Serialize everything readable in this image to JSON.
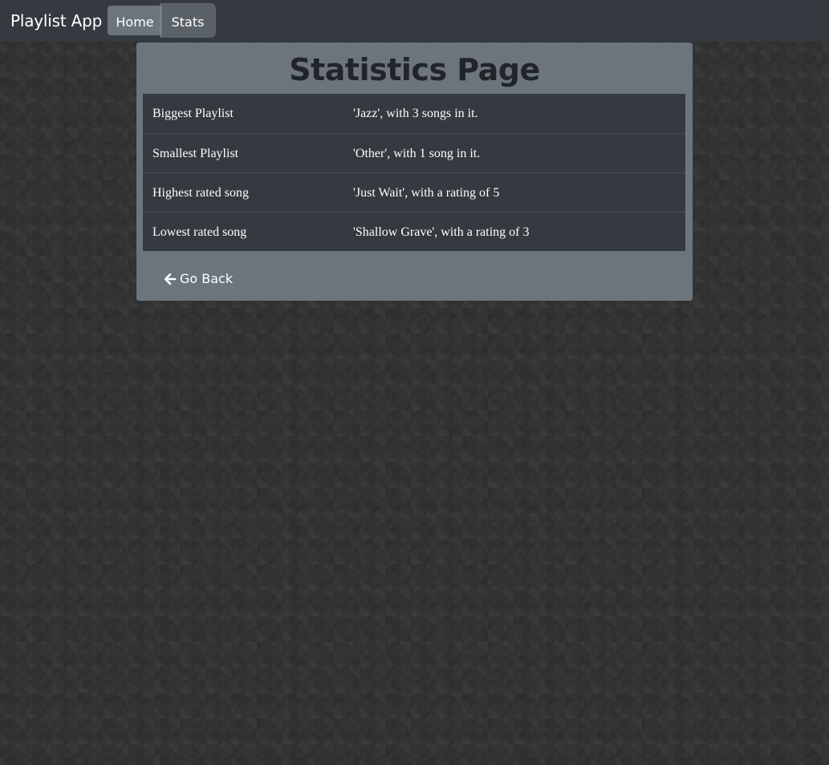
{
  "navbar": {
    "brand": "Playlist App",
    "links": [
      {
        "label": "Home"
      },
      {
        "label": "Stats"
      }
    ]
  },
  "page": {
    "title": "Statistics Page",
    "stats": [
      {
        "label": "Biggest Playlist",
        "value": "'Jazz', with 3 songs in it."
      },
      {
        "label": "Smallest Playlist",
        "value": "'Other', with 1 song in it."
      },
      {
        "label": "Highest rated song",
        "value": "'Just Wait', with a rating of 5"
      },
      {
        "label": "Lowest rated song",
        "value": "'Shallow Grave', with a rating of 3"
      }
    ],
    "back_label": "Go Back",
    "back_icon": "arrow-left-icon"
  },
  "colors": {
    "navbar_bg": "#343a40",
    "card_bg": "#6c757d",
    "table_bg": "#343a40",
    "title_color": "#212529"
  }
}
